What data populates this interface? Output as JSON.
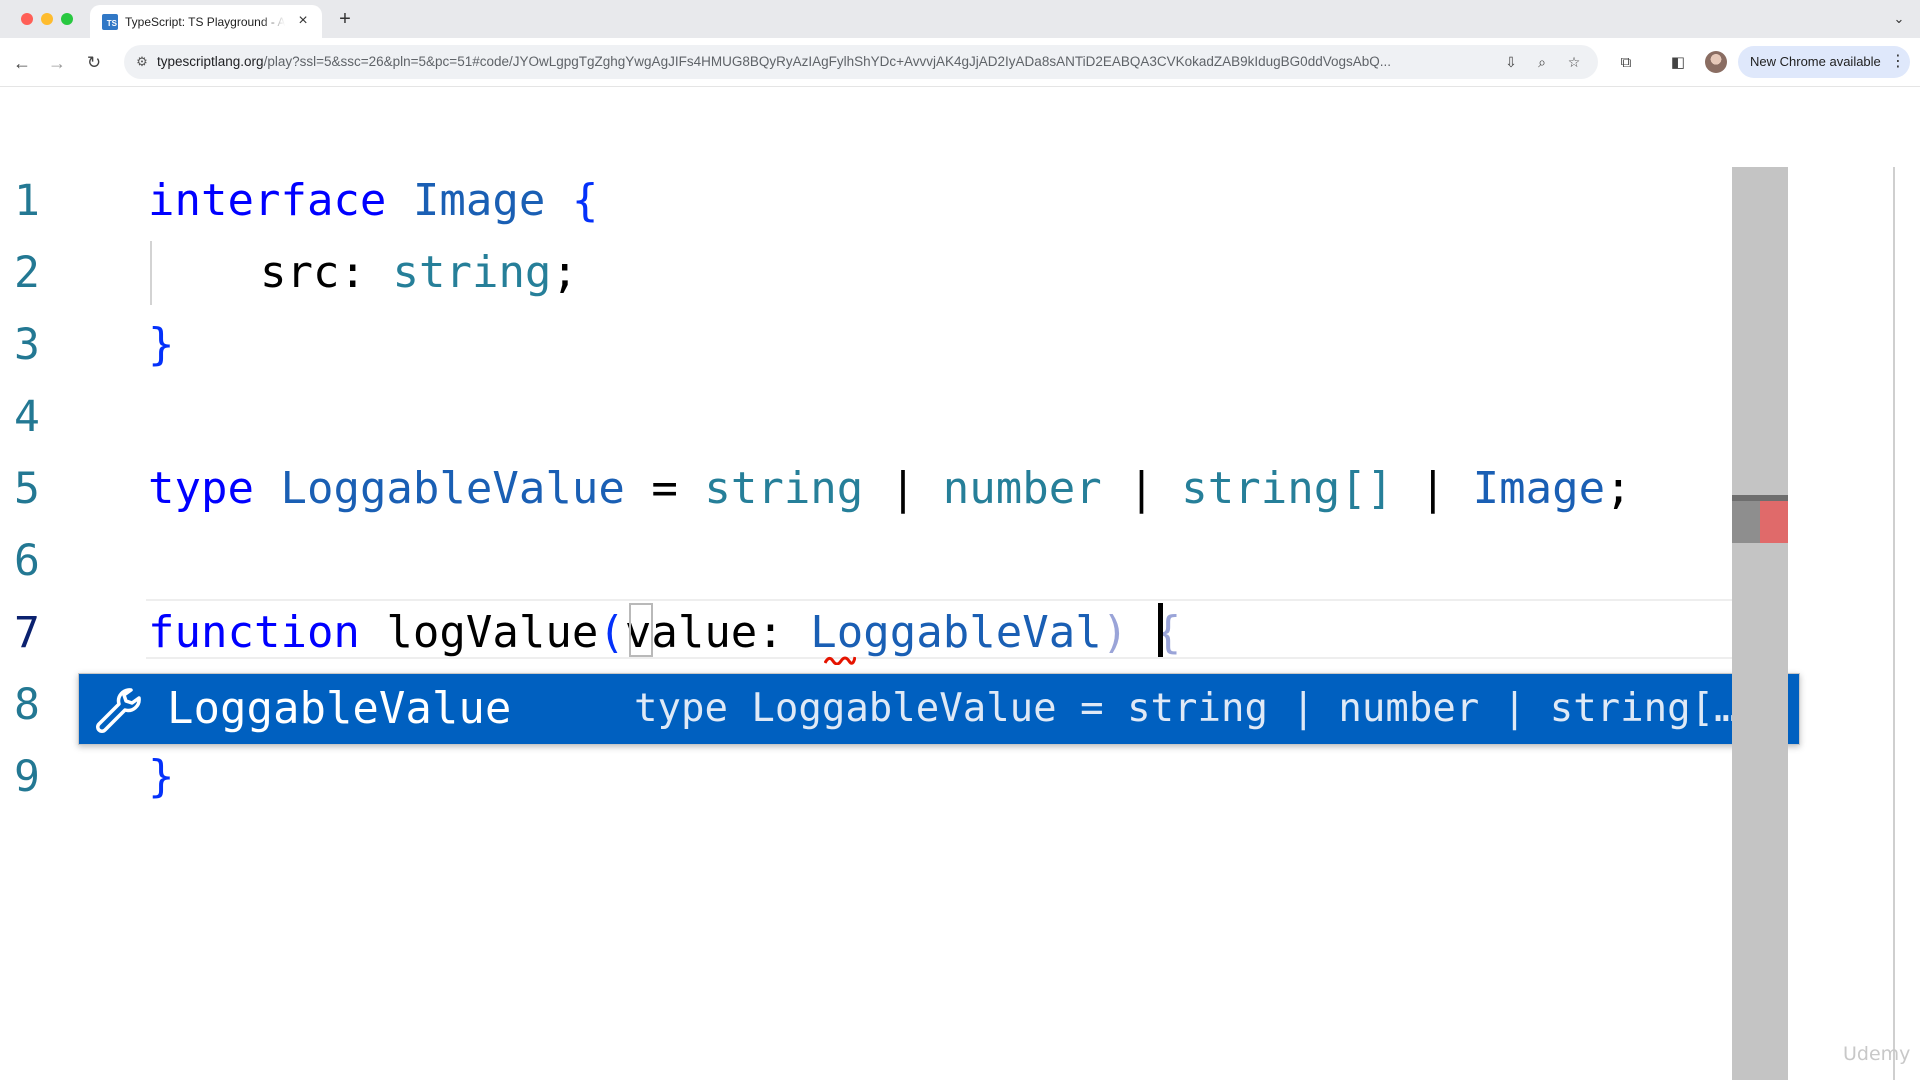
{
  "browser": {
    "tab_title": "TypeScript: TS Playground - An",
    "favicon_text": "TS",
    "url_host": "typescriptlang.org",
    "url_path": "/play?ssl=5&ssc=26&pln=5&pc=51#code/JYOwLgpgTgZghgYwgAgJIFs4HMUG8BQyRyAzIAgFylhShYDc+AvvvjAK4gJjAD2IyADa8sANTiD2EABQA3CVKokadZAB9kIdugBG0ddVogsAbQ...",
    "new_chrome_label": "New Chrome available"
  },
  "editor": {
    "line_numbers": [
      "1",
      "2",
      "3",
      "4",
      "5",
      "6",
      "7",
      "8",
      "9"
    ],
    "lines": {
      "l1": {
        "kw": "interface",
        "name": "Image",
        "brace": "{"
      },
      "l2": {
        "prop": "src",
        "colon": ":",
        "type": "string",
        "semi": ";"
      },
      "l3": {
        "brace": "}"
      },
      "l5": {
        "kw": "type",
        "name": "LoggableValue",
        "eq": "=",
        "t1": "string",
        "p1": "|",
        "t2": "number",
        "p2": "|",
        "t3": "string[]",
        "p3": "|",
        "t4": "Image",
        "semi": ";"
      },
      "l7": {
        "kw": "function",
        "name": "logValue",
        "open": "(",
        "param": "value",
        "colon": ":",
        "typed": "LoggableVal",
        "close": ")",
        "brace": "{"
      },
      "l9": {
        "brace": "}"
      }
    }
  },
  "autocomplete": {
    "icon": "wrench-icon",
    "label": "LoggableValue",
    "detail": "type LoggableValue = string | number | string[…"
  },
  "watermark": "Udemy",
  "colors": {
    "keyword": "#0000ff",
    "type": "#267f99",
    "suggest_bg": "#0060c0",
    "line_number": "#237893"
  }
}
